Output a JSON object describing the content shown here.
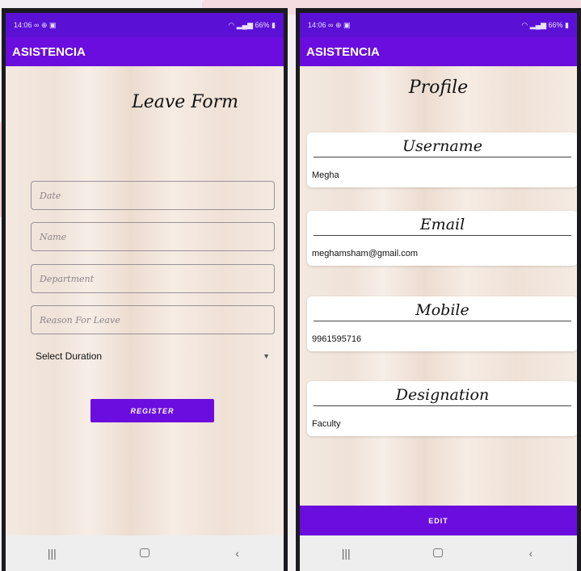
{
  "left_phone": {
    "status": {
      "time": "14:06",
      "icons": "∞ ⊕ ▣",
      "battery": "66%"
    },
    "appbar": {
      "title": "ASISTENCIA"
    },
    "form": {
      "title": "Leave Form",
      "date_placeholder": "Date",
      "name_placeholder": "Name",
      "department_placeholder": "Department",
      "reason_placeholder": "Reason For Leave",
      "duration_select": "Select Duration",
      "register_label": "REGISTER"
    },
    "nav": {
      "recents": "|||",
      "back": "‹"
    }
  },
  "right_phone": {
    "status": {
      "time": "14:06",
      "icons": "∞ ⊕ ▣",
      "battery": "66%"
    },
    "appbar": {
      "title": "ASISTENCIA"
    },
    "profile": {
      "title": "Profile",
      "username_label": "Username",
      "username_value": "Megha",
      "email_label": "Email",
      "email_value": "meghamsham@gmail.com",
      "mobile_label": "Mobile",
      "mobile_value": "9961595716",
      "designation_label": "Designation",
      "designation_value": "Faculty",
      "edit_label": "EDIT"
    },
    "nav": {
      "recents": "|||",
      "back": "‹"
    }
  },
  "colors": {
    "primary": "#6a0dde",
    "statusbar": "#5b10d6"
  },
  "icons": [
    "wifi-icon",
    "signal-icon",
    "battery-icon",
    "recents-icon",
    "home-icon",
    "back-icon",
    "dropdown-caret-icon"
  ]
}
